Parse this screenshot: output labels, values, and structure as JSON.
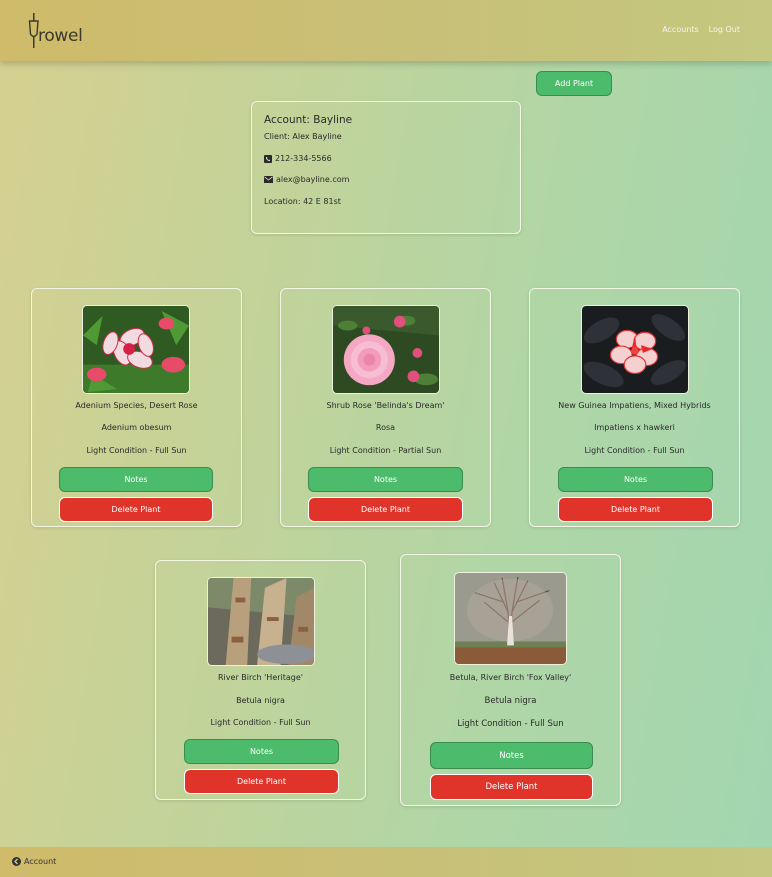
{
  "header": {
    "logo_text": "rowel",
    "nav": [
      "Accounts",
      "Log Out"
    ]
  },
  "actions": {
    "add_plant": "Add Plant"
  },
  "account": {
    "title": "Account: Bayline",
    "client": "Client: Alex Bayline",
    "phone": "212-334-5566",
    "email": "alex@bayline.com",
    "location": "Location: 42 E 81st"
  },
  "plants": [
    {
      "common": "Adenium Species, Desert Rose",
      "botanical": "Adenium obesum",
      "light": "Light Condition - Full Sun",
      "notes": "Notes",
      "delete": "Delete Plant",
      "image": "desert-rose-photo"
    },
    {
      "common": "Shrub Rose 'Belinda's Dream'",
      "botanical": "Rosa",
      "light": "Light Condition - Partial Sun",
      "notes": "Notes",
      "delete": "Delete Plant",
      "image": "pink-rose-photo"
    },
    {
      "common": "New Guinea Impatiens, Mixed Hybrids",
      "botanical": "Impatiens x hawkeri",
      "light": "Light Condition - Full Sun",
      "notes": "Notes",
      "delete": "Delete Plant",
      "image": "impatiens-photo"
    },
    {
      "common": "River Birch 'Heritage'",
      "botanical": "Betula nigra",
      "light": "Light Condition - Full Sun",
      "notes": "Notes",
      "delete": "Delete Plant",
      "image": "birch-bark-photo"
    },
    {
      "common": "Betula, River Birch 'Fox Valley'",
      "botanical": "Betula nigra",
      "light": "Light Condition - Full Sun",
      "notes": "Notes",
      "delete": "Delete Plant",
      "image": "birch-tree-photo"
    }
  ],
  "footer": {
    "back_link": "Account"
  },
  "colors": {
    "accent_green": "#4cbb6c",
    "danger_red": "#e0342a",
    "nav_gold": "#cfbb6a"
  }
}
